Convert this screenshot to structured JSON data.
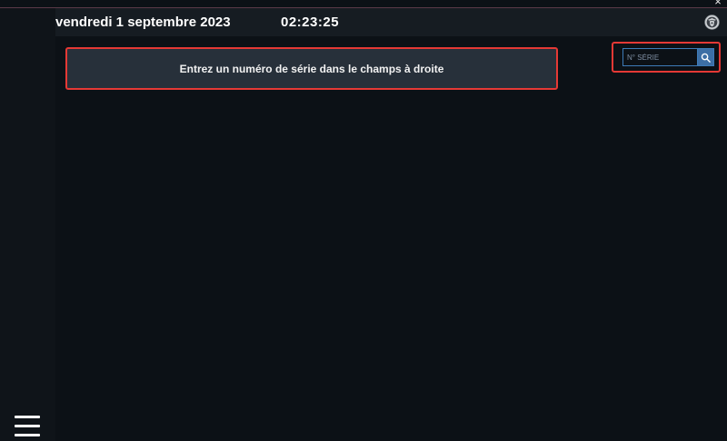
{
  "window": {
    "close_glyph": "×"
  },
  "header": {
    "date": "vendredi 1 septembre 2023",
    "time": "02:23:25",
    "emblem_icon": "emblem-icon"
  },
  "main": {
    "message": "Entrez un numéro de série dans le champs à droite"
  },
  "search": {
    "placeholder": "N° SÉRIE",
    "value": "",
    "button_icon": "search-icon"
  },
  "sidebar": {
    "menu_icon": "hamburger-menu-icon"
  },
  "colors": {
    "background": "#0c1116",
    "header": "#161c22",
    "panel": "#27303a",
    "highlight": "#e53935",
    "accent": "#3d6fa5"
  }
}
